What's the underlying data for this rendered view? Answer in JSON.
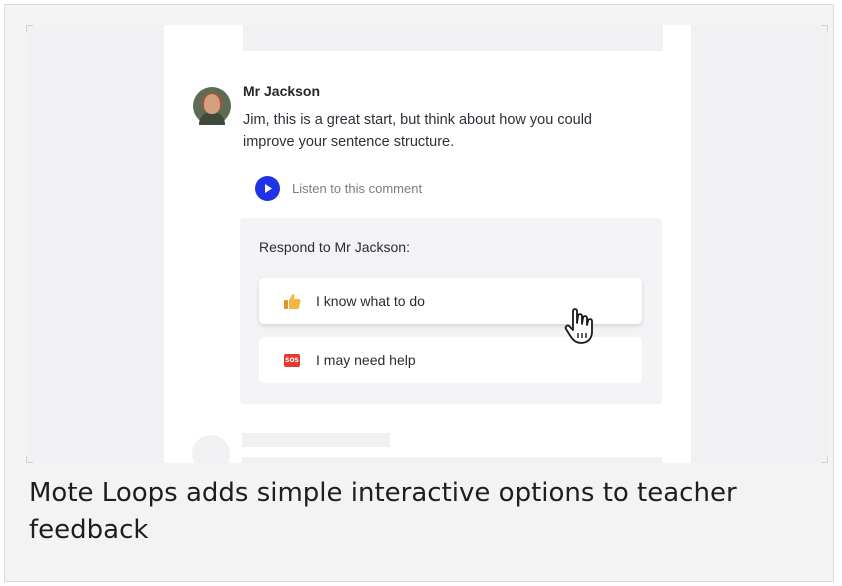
{
  "comment": {
    "author": "Mr Jackson",
    "text": "Jim, this is a great start, but think about how you could improve your sentence structure.",
    "listen_label": "Listen to this comment"
  },
  "respond": {
    "title": "Respond to Mr Jackson:",
    "options": [
      {
        "label": "I know what to do",
        "icon": "thumbs-up-icon"
      },
      {
        "label": "I may need help",
        "icon": "sos-icon",
        "icon_text": "SOS"
      }
    ]
  },
  "caption": "Mote Loops adds simple interactive options to teacher feedback",
  "colors": {
    "accent": "#1f33e6",
    "sos": "#e53a2f",
    "thumb": "#f4b63f"
  }
}
